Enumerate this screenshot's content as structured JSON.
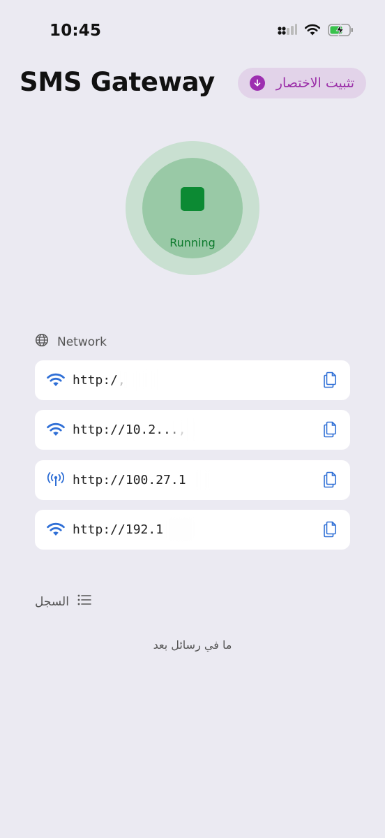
{
  "status_bar": {
    "time": "10:45"
  },
  "header": {
    "title": "SMS Gateway",
    "pin_label": "تثبيت الاختصار"
  },
  "toggle": {
    "state_label": "Running",
    "color": "#0c8a33"
  },
  "network": {
    "title": "Network",
    "items": [
      {
        "url": "http:/,",
        "icon": "wifi-icon"
      },
      {
        "url": "http://10.2..., ",
        "icon": "wifi-icon"
      },
      {
        "url": "http://100.27.1",
        "icon": "antenna-icon"
      },
      {
        "url": "http://192.1",
        "icon": "wifi-icon"
      }
    ]
  },
  "log": {
    "title": "السجل",
    "empty_text": "ما في رسائل بعد"
  },
  "colors": {
    "accent_blue": "#2f6fd6",
    "pin_purple": "#9b2ea8",
    "background": "#ebeaf2"
  }
}
